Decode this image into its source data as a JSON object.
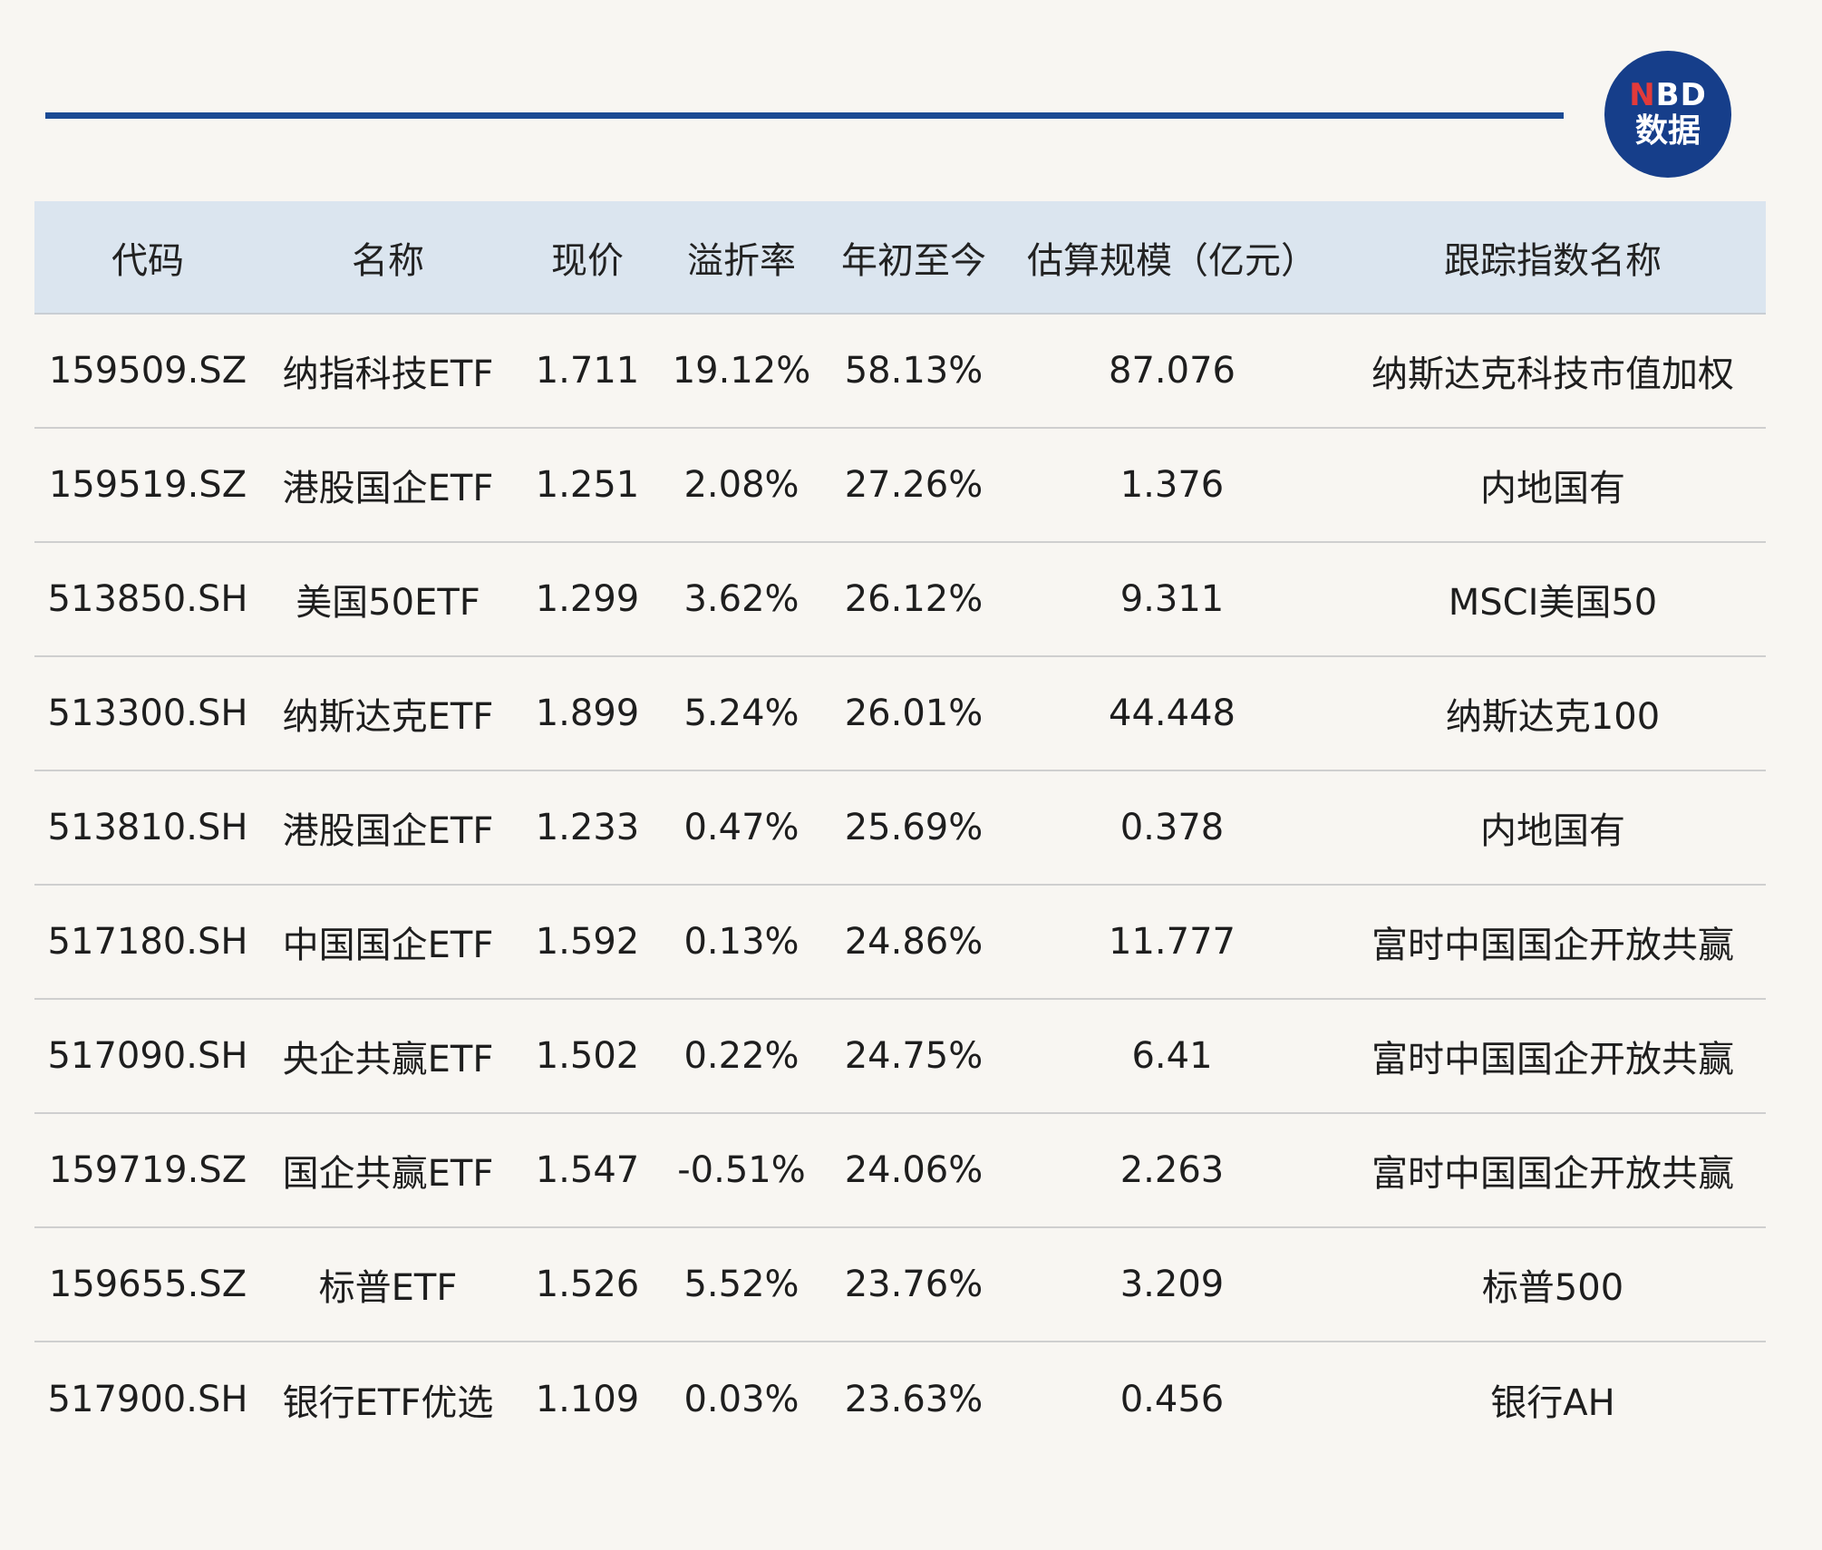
{
  "logo": {
    "line1_n": "N",
    "line1_rest": "BD",
    "line2": "数据"
  },
  "chart_data": {
    "type": "table",
    "columns": [
      "代码",
      "名称",
      "现价",
      "溢折率",
      "年初至今",
      "估算规模（亿元）",
      "跟踪指数名称"
    ],
    "rows": [
      [
        "159509.SZ",
        "纳指科技ETF",
        "1.711",
        "19.12%",
        "58.13%",
        "87.076",
        "纳斯达克科技市值加权"
      ],
      [
        "159519.SZ",
        "港股国企ETF",
        "1.251",
        "2.08%",
        "27.26%",
        "1.376",
        "内地国有"
      ],
      [
        "513850.SH",
        "美国50ETF",
        "1.299",
        "3.62%",
        "26.12%",
        "9.311",
        "MSCI美国50"
      ],
      [
        "513300.SH",
        "纳斯达克ETF",
        "1.899",
        "5.24%",
        "26.01%",
        "44.448",
        "纳斯达克100"
      ],
      [
        "513810.SH",
        "港股国企ETF",
        "1.233",
        "0.47%",
        "25.69%",
        "0.378",
        "内地国有"
      ],
      [
        "517180.SH",
        "中国国企ETF",
        "1.592",
        "0.13%",
        "24.86%",
        "11.777",
        "富时中国国企开放共赢"
      ],
      [
        "517090.SH",
        "央企共赢ETF",
        "1.502",
        "0.22%",
        "24.75%",
        "6.41",
        "富时中国国企开放共赢"
      ],
      [
        "159719.SZ",
        "国企共赢ETF",
        "1.547",
        "-0.51%",
        "24.06%",
        "2.263",
        "富时中国国企开放共赢"
      ],
      [
        "159655.SZ",
        "标普ETF",
        "1.526",
        "5.52%",
        "23.76%",
        "3.209",
        "标普500"
      ],
      [
        "517900.SH",
        "银行ETF优选",
        "1.109",
        "0.03%",
        "23.63%",
        "0.456",
        "银行AH"
      ]
    ]
  },
  "colors": {
    "background": "#f8f6f2",
    "accent_line": "#1a4a94",
    "header_bg": "#dbe5ef",
    "logo_bg": "#163e8a",
    "logo_n": "#e23a3a"
  }
}
